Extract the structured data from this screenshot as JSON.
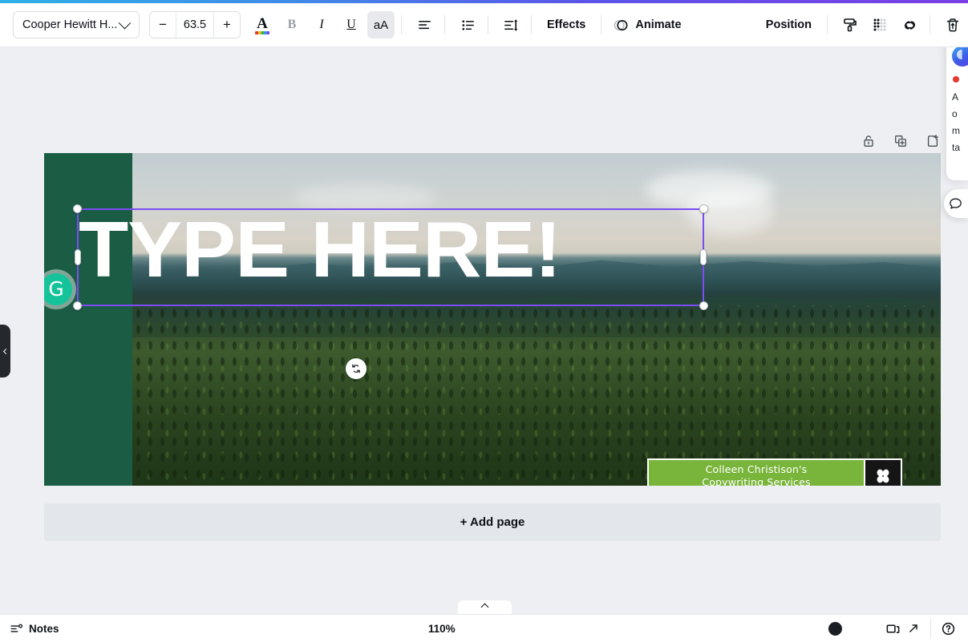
{
  "toolbar": {
    "font_name": "Cooper Hewitt H...",
    "font_size": "63.5",
    "decrease_label": "−",
    "increase_label": "+",
    "text_color_label": "A",
    "bold_label": "B",
    "italic_label": "I",
    "underline_label": "U",
    "case_label": "aA",
    "effects_label": "Effects",
    "animate_label": "Animate",
    "position_label": "Position",
    "icons": {
      "align": "align-left-icon",
      "list": "bullet-list-icon",
      "spacing": "line-spacing-icon",
      "animate": "animate-circles-icon",
      "paint": "paint-roller-icon",
      "transparency": "transparency-icon",
      "link": "link-icon",
      "delete": "trash-icon"
    }
  },
  "page_tools": {
    "lock": "Lock",
    "duplicate": "Duplicate page",
    "add": "Add page"
  },
  "design": {
    "headline": "TYPE HERE!",
    "badge_line1": "Colleen Christison's",
    "badge_line2": "Copywriting Services",
    "badge_icon": "clover-icon",
    "green_band_color": "#1b5c44",
    "badge_green": "#79b53b",
    "selection_color": "#7a4df5",
    "grammarly_letter": "G",
    "grammarly_color": "#15c39a"
  },
  "canvas": {
    "add_page_label": "+ Add page"
  },
  "comments": {
    "line1": "A",
    "line2": "o",
    "line3": "m",
    "line4": "ta"
  },
  "statusbar": {
    "notes_label": "Notes",
    "zoom_level": "110%"
  }
}
